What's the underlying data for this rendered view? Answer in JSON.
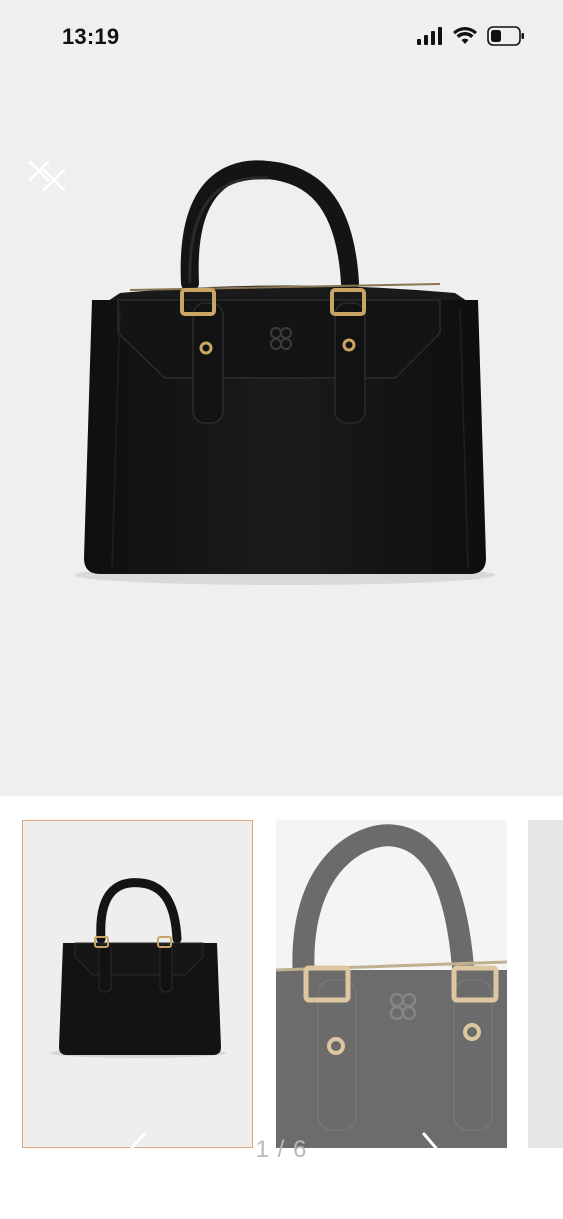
{
  "status_bar": {
    "time": "13:19",
    "icons": [
      "signal-icon",
      "wifi-icon",
      "battery-icon"
    ]
  },
  "gallery": {
    "close_icon": "close-icon",
    "current_index": 1,
    "total": 6,
    "counter_text": "1 / 6",
    "prev_icon": "chevron-left-icon",
    "next_icon": "chevron-right-icon",
    "selected_border_color": "#e0a37c",
    "background": "#efefef"
  },
  "thumbnails": [
    {
      "subject": "handbag-front-view",
      "selected": true
    },
    {
      "subject": "handbag-closeup-view",
      "selected": false
    },
    {
      "subject": "handbag-partial-view",
      "selected": false
    }
  ]
}
